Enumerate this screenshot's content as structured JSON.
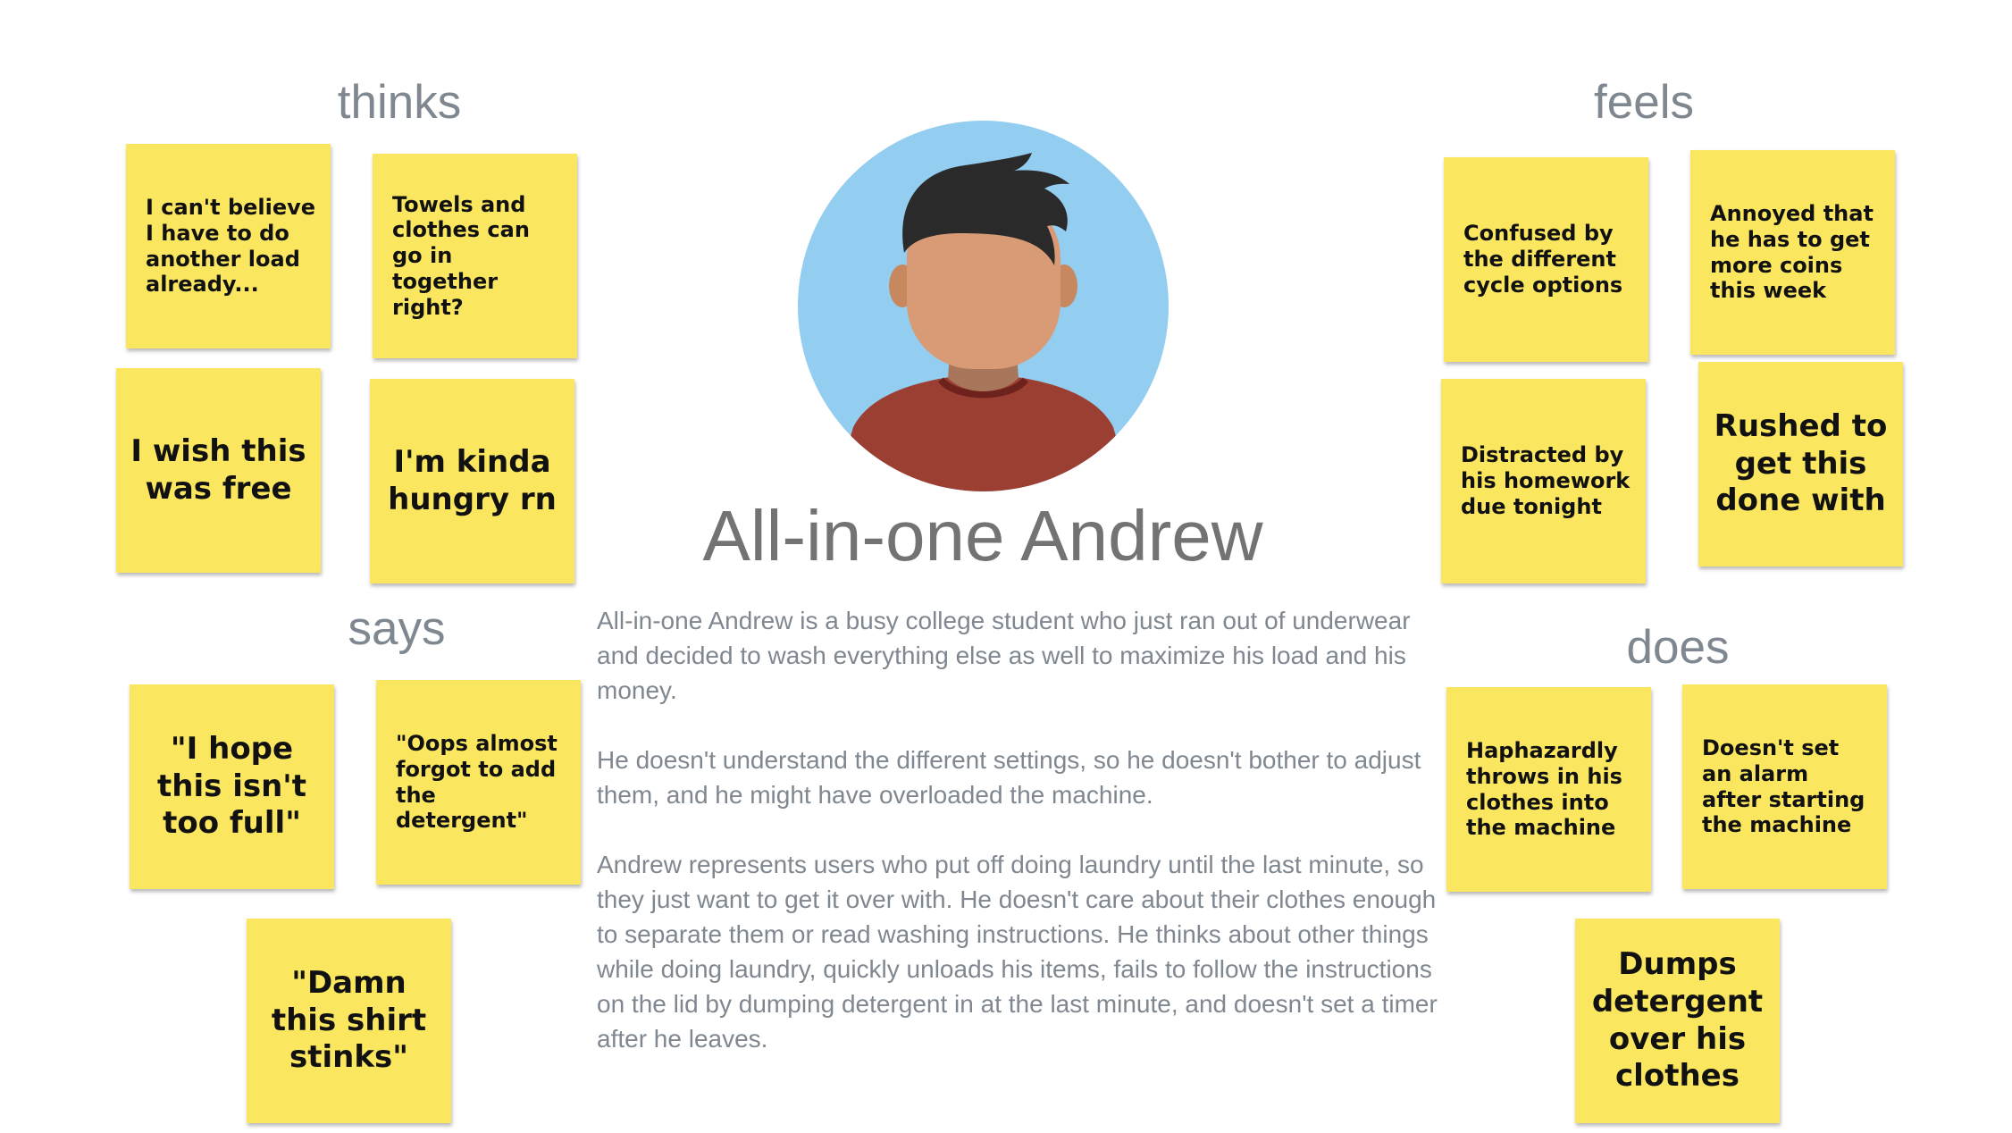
{
  "persona": {
    "name": "All-in-one Andrew",
    "description": [
      "All-in-one Andrew is a busy college student who just ran out of underwear and decided to wash everything else as well to maximize his load and his money.",
      "He doesn't understand the different settings, so he doesn't bother to adjust them, and he might have overloaded the machine.",
      "Andrew represents users who put off doing laundry until the last minute, so they just want to get it over with. He doesn't care about their clothes enough to separate them or read washing instructions. He thinks about other things while doing laundry, quickly unloads his items, fails to follow the instructions on the lid by dumping detergent in at the last minute, and doesn't set a timer after he leaves."
    ]
  },
  "quadrants": {
    "thinks": {
      "label": "thinks",
      "notes": [
        "I can't believe I have to do another load already...",
        "Towels and clothes can go in together right?",
        "I wish this was free",
        "I'm kinda hungry rn"
      ]
    },
    "feels": {
      "label": "feels",
      "notes": [
        "Confused by the different cycle options",
        "Annoyed that he has to get more coins this week",
        "Distracted by his homework due tonight",
        "Rushed to get this done with"
      ]
    },
    "says": {
      "label": "says",
      "notes": [
        "\"I hope this isn't too full\"",
        "\"Oops almost forgot to add the detergent\"",
        "\"Damn this shirt stinks\""
      ]
    },
    "does": {
      "label": "does",
      "notes": [
        "Haphazardly throws in his clothes into the machine",
        "Doesn't set an alarm after starting the machine",
        "Dumps detergent over his clothes"
      ]
    }
  },
  "colors": {
    "note": "#fae75f",
    "avatar_background": "#93cdf0",
    "skin": "#d99b76",
    "hair": "#2a2a2a",
    "shirt": "#9c3f33",
    "label": "#7f8790",
    "name": "#737373"
  }
}
